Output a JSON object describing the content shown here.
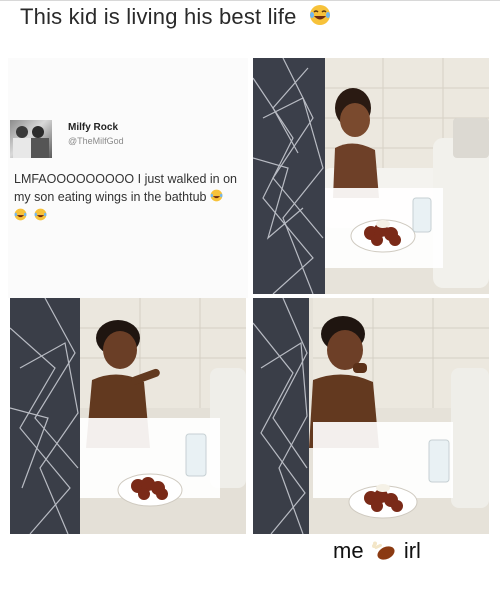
{
  "header": {
    "caption": "This kid is living his best life"
  },
  "tweet": {
    "display_name": "Milfy Rock",
    "handle": "@TheMilfGod",
    "text_line1": "LMFAOOOOOOOOO I just walked in on",
    "text_line2": "my son eating wings in the bathtub"
  },
  "footer": {
    "caption_left": "me",
    "caption_right": "irl"
  },
  "icons": {
    "laughing": "laughing-crying-emoji",
    "drumstick": "poultry-leg-emoji"
  },
  "colors": {
    "emoji_yellow": "#f7c23a",
    "drumstick_brown": "#8b3a12"
  }
}
